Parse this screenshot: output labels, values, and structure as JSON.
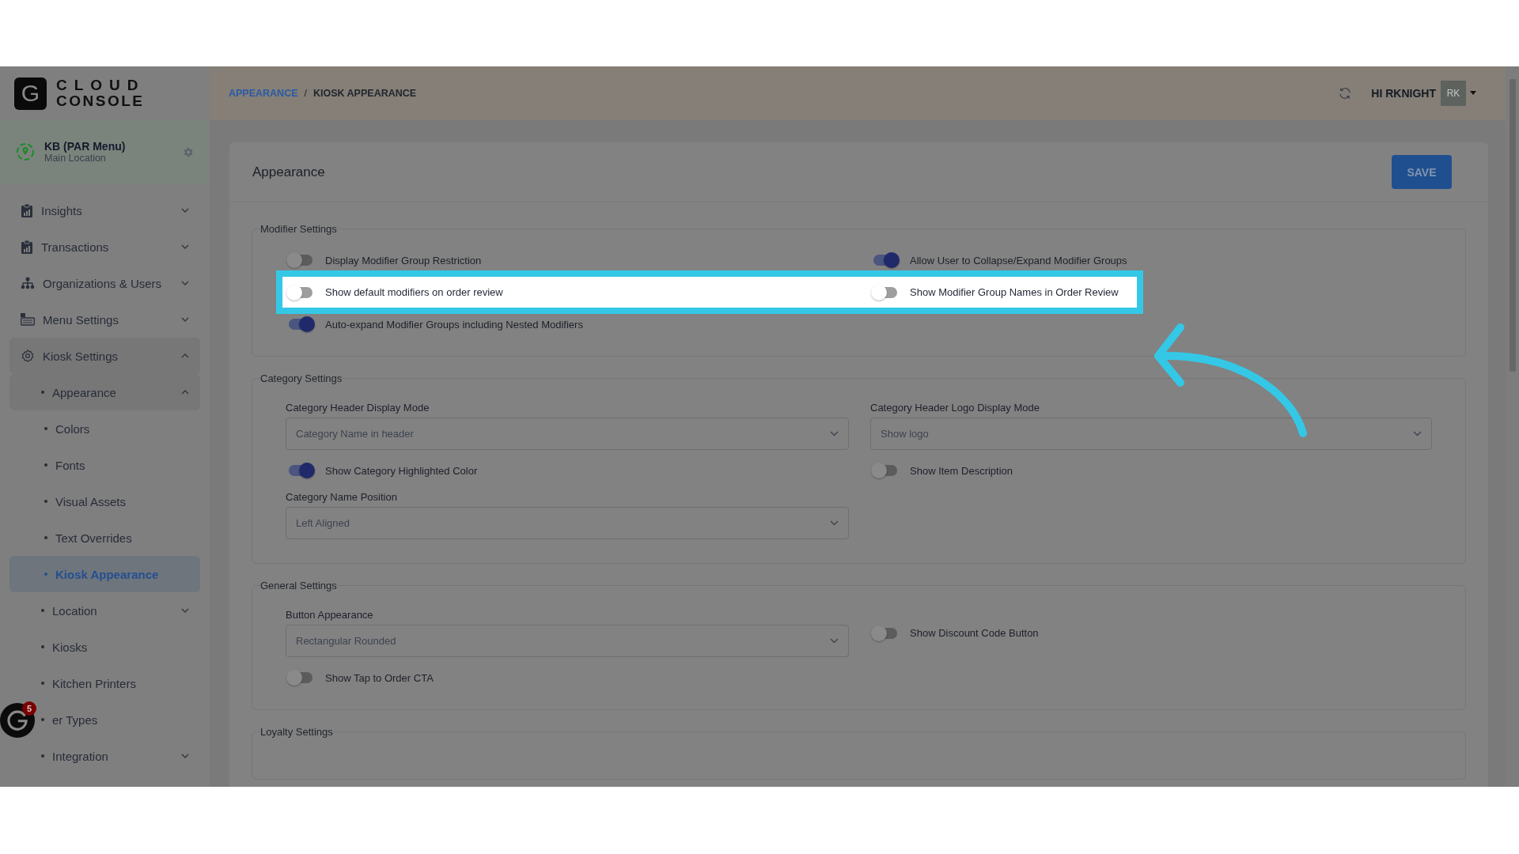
{
  "logo": {
    "mark": "G",
    "line1": "CLOUD",
    "line2": "CONSOLE"
  },
  "location": {
    "name": "KB (PAR Menu)",
    "subtitle": "Main Location"
  },
  "sidebar": {
    "items": [
      {
        "label": "Insights",
        "kind": "report",
        "expanded": false,
        "selected": false
      },
      {
        "label": "Transactions",
        "kind": "report",
        "expanded": false,
        "selected": false
      },
      {
        "label": "Organizations & Users",
        "kind": "org",
        "expanded": false,
        "selected": false
      },
      {
        "label": "Menu Settings",
        "kind": "menu",
        "expanded": false,
        "selected": false
      },
      {
        "label": "Kiosk Settings",
        "kind": "gear",
        "expanded": true,
        "selected": false,
        "children": [
          {
            "label": "Appearance",
            "kind": "bullet",
            "expanded": true,
            "selected": false,
            "children": [
              {
                "label": "Colors",
                "kind": "bullet",
                "selected": false
              },
              {
                "label": "Fonts",
                "kind": "bullet",
                "selected": false
              },
              {
                "label": "Visual Assets",
                "kind": "bullet",
                "selected": false
              },
              {
                "label": "Text Overrides",
                "kind": "bullet",
                "selected": false
              },
              {
                "label": "Kiosk Appearance",
                "kind": "bullet",
                "selected": true
              }
            ]
          },
          {
            "label": "Location",
            "kind": "bullet",
            "expanded": false,
            "selected": false
          },
          {
            "label": "Kiosks",
            "kind": "bullet",
            "selected": false
          },
          {
            "label": "Kitchen Printers",
            "kind": "bullet",
            "selected": false
          },
          {
            "label": "er Types",
            "kind": "bullet",
            "selected": false
          },
          {
            "label": "Integration",
            "kind": "bullet",
            "expanded": false,
            "selected": false
          }
        ]
      }
    ]
  },
  "chat_badge": {
    "count": "5"
  },
  "breadcrumb": {
    "items": [
      "APPEARANCE",
      "KIOSK APPEARANCE"
    ],
    "separator": "/"
  },
  "user": {
    "greeting": "HI RKNIGHT",
    "initials": "RK"
  },
  "card": {
    "title": "Appearance",
    "save": "SAVE"
  },
  "sections": [
    {
      "title": "Modifier Settings",
      "rows": [
        {
          "highlighted": false,
          "cells": [
            {
              "kind": "toggle",
              "label": "Display Modifier Group Restriction",
              "on": false
            },
            {
              "kind": "toggle",
              "label": "Allow User to Collapse/Expand Modifier Groups",
              "on": true
            }
          ]
        },
        {
          "highlighted": true,
          "cells": [
            {
              "kind": "toggle",
              "label": "Show default modifiers on order review",
              "on": false
            },
            {
              "kind": "toggle",
              "label": "Show Modifier Group Names in Order Review",
              "on": false
            }
          ]
        },
        {
          "highlighted": false,
          "cells": [
            {
              "kind": "toggle",
              "label": "Auto-expand Modifier Groups including Nested Modifiers",
              "on": true
            }
          ]
        }
      ]
    },
    {
      "title": "Category Settings",
      "rows": [
        {
          "highlighted": false,
          "cells": [
            {
              "kind": "select",
              "label": "Category Header Display Mode",
              "value": "Category Name in header"
            },
            {
              "kind": "select",
              "label": "Category Header Logo Display Mode",
              "value": "Show logo"
            }
          ]
        },
        {
          "highlighted": false,
          "cells": [
            {
              "kind": "toggle",
              "label": "Show Category Highlighted Color",
              "on": true
            },
            {
              "kind": "toggle",
              "label": "Show Item Description",
              "on": false
            }
          ]
        },
        {
          "highlighted": false,
          "cells": [
            {
              "kind": "select",
              "label": "Category Name Position",
              "value": "Left Aligned"
            }
          ]
        }
      ]
    },
    {
      "title": "General Settings",
      "rows": [
        {
          "highlighted": false,
          "cells": [
            {
              "kind": "select",
              "label": "Button Appearance",
              "value": "Rectangular Rounded"
            },
            {
              "kind": "toggle",
              "label": "Show Discount Code Button",
              "on": false
            }
          ]
        },
        {
          "highlighted": false,
          "cells": [
            {
              "kind": "toggle",
              "label": "Show Tap to Order CTA",
              "on": false
            }
          ]
        }
      ]
    },
    {
      "title": "Loyalty Settings"
    }
  ]
}
